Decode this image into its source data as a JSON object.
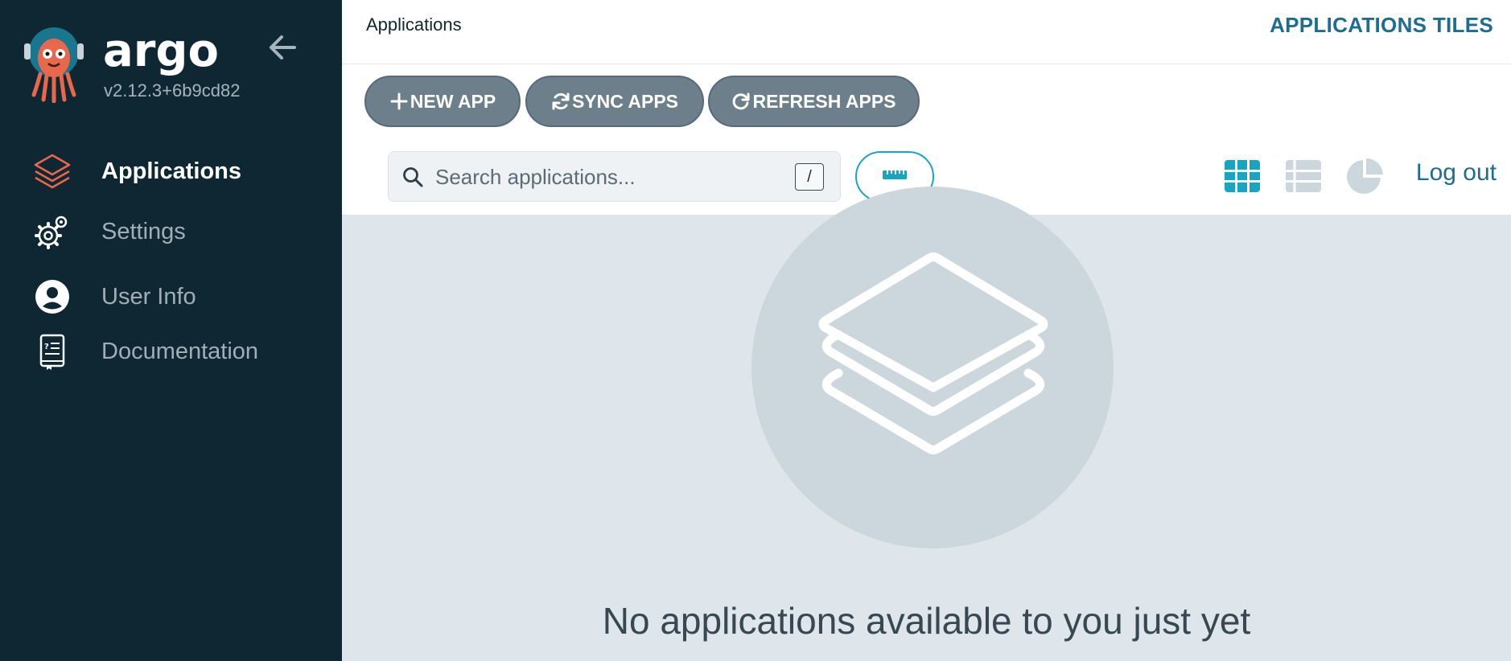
{
  "sidebar": {
    "brand": "argo",
    "version": "v2.12.3+6b9cd82",
    "collapse_icon": "arrow-left-icon",
    "items": [
      {
        "label": "Applications",
        "icon": "layers-icon",
        "active": true
      },
      {
        "label": "Settings",
        "icon": "gears-icon",
        "active": false
      },
      {
        "label": "User Info",
        "icon": "user-circle-icon",
        "active": false
      },
      {
        "label": "Documentation",
        "icon": "book-icon",
        "active": false
      }
    ]
  },
  "header": {
    "page_title": "Applications",
    "view_title": "APPLICATIONS TILES"
  },
  "toolbar": {
    "new_app": "NEW APP",
    "sync_apps": "SYNC APPS",
    "refresh_apps": "REFRESH APPS"
  },
  "search": {
    "placeholder": "Search applications...",
    "shortcut": "/"
  },
  "view_switcher": {
    "tiles_icon": "grid-icon",
    "list_icon": "list-icon",
    "summary_icon": "pie-chart-icon",
    "active": "tiles"
  },
  "logout": "Log out",
  "empty_state": {
    "message": "No applications available to you just yet"
  },
  "colors": {
    "sidebar_bg": "#0f2733",
    "accent": "#16a6c3",
    "button_bg": "#6d7f8b",
    "content_bg": "#dee6eb",
    "logo_orange": "#e9684b"
  }
}
